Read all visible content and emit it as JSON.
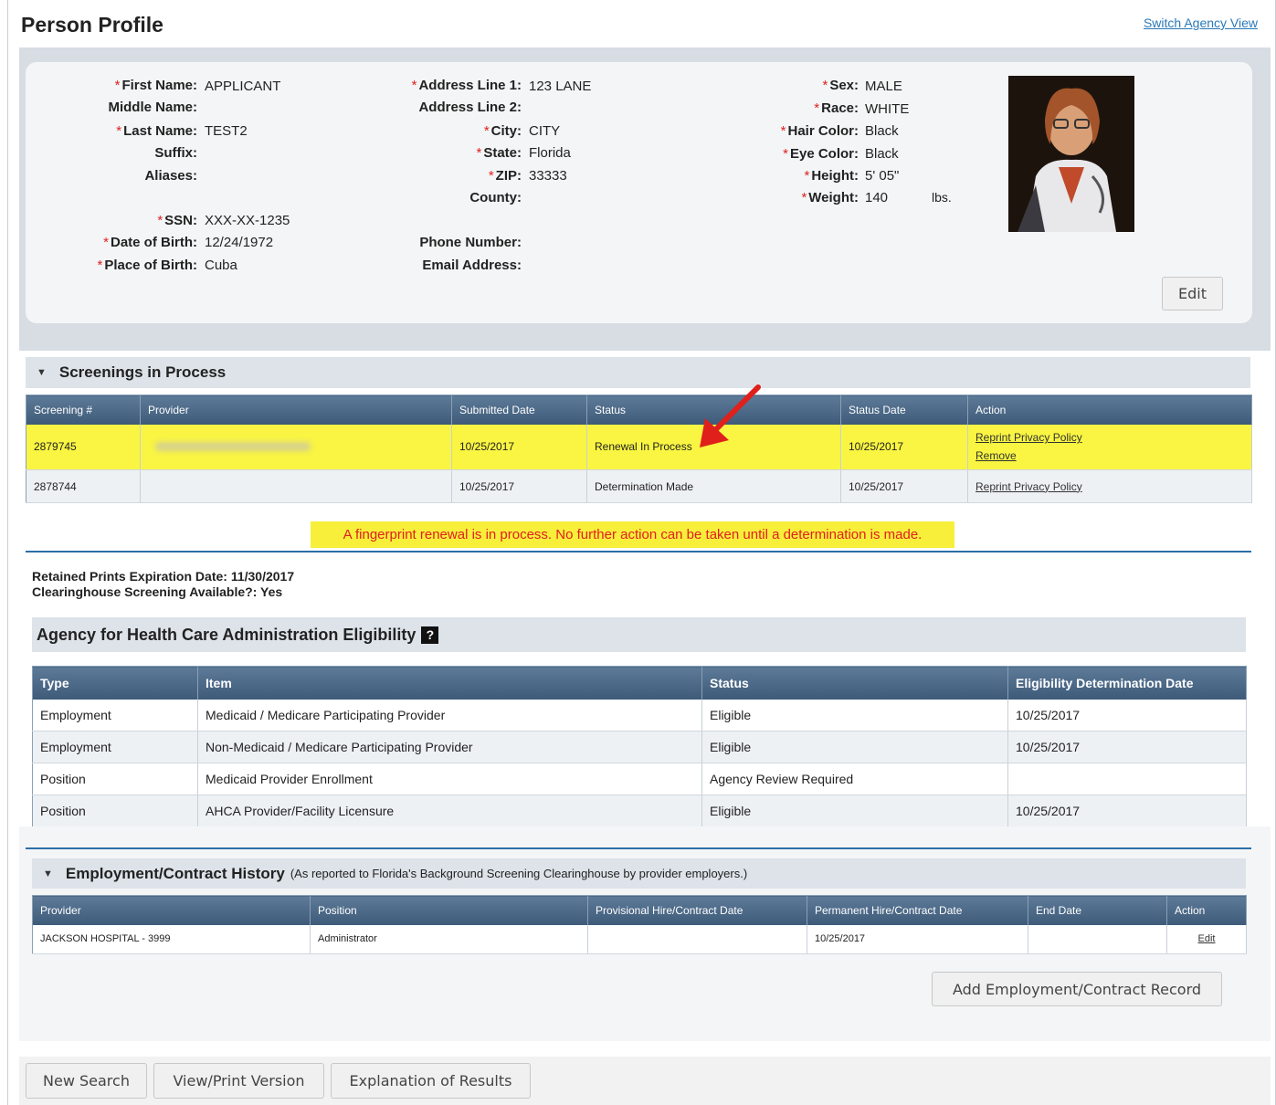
{
  "header": {
    "title": "Person Profile",
    "switch_link": "Switch Agency View"
  },
  "person": {
    "col1": [
      {
        "label": "First Name:",
        "required": true,
        "value": "APPLICANT"
      },
      {
        "label": "Middle Name:",
        "required": false,
        "value": ""
      },
      {
        "label": "Last Name:",
        "required": true,
        "value": "TEST2"
      },
      {
        "label": "Suffix:",
        "required": false,
        "value": ""
      },
      {
        "label": "Aliases:",
        "required": false,
        "value": ""
      },
      {
        "label": "SSN:",
        "required": true,
        "value": "XXX-XX-1235"
      },
      {
        "label": "Date of Birth:",
        "required": true,
        "value": "12/24/1972"
      },
      {
        "label": "Place of Birth:",
        "required": true,
        "value": "Cuba"
      }
    ],
    "col2": [
      {
        "label": "Address Line 1:",
        "required": true,
        "value": "123 LANE"
      },
      {
        "label": "Address Line 2:",
        "required": false,
        "value": ""
      },
      {
        "label": "City:",
        "required": true,
        "value": "CITY"
      },
      {
        "label": "State:",
        "required": true,
        "value": "Florida"
      },
      {
        "label": "ZIP:",
        "required": true,
        "value": "33333"
      },
      {
        "label": "County:",
        "required": false,
        "value": ""
      },
      {
        "label": "Phone Number:",
        "required": false,
        "value": ""
      },
      {
        "label": "Email Address:",
        "required": false,
        "value": ""
      }
    ],
    "col3": [
      {
        "label": "Sex:",
        "required": true,
        "value": "MALE"
      },
      {
        "label": "Race:",
        "required": true,
        "value": "WHITE"
      },
      {
        "label": "Hair Color:",
        "required": true,
        "value": "Black"
      },
      {
        "label": "Eye Color:",
        "required": true,
        "value": "Black"
      },
      {
        "label": "Height:",
        "required": true,
        "value": "5' 05\""
      },
      {
        "label": "Weight:",
        "required": true,
        "value": "140",
        "unit": "lbs."
      }
    ],
    "required_mark": "*",
    "edit_button": "Edit"
  },
  "screenings": {
    "title": "Screenings in Process",
    "columns": [
      "Screening #",
      "Provider",
      "Submitted Date",
      "Status",
      "Status Date",
      "Action"
    ],
    "rows": [
      {
        "number": "2879745",
        "provider": "",
        "submitted": "10/25/2017",
        "status": "Renewal In Process",
        "status_date": "10/25/2017",
        "action1": "Reprint Privacy Policy",
        "action2": "Remove"
      },
      {
        "number": "2878744",
        "provider": "",
        "submitted": "10/25/2017",
        "status": "Determination Made",
        "status_date": "10/25/2017",
        "action1": "Reprint Privacy Policy"
      }
    ],
    "notice": "A fingerprint renewal is in process. No further action can be taken until a determination is made."
  },
  "retained": {
    "expiration": "Retained Prints Expiration Date: 11/30/2017",
    "clearinghouse": "Clearinghouse Screening Available?: Yes"
  },
  "eligibility": {
    "title": "Agency for Health Care Administration Eligibility",
    "help_icon": "?",
    "columns": [
      "Type",
      "Item",
      "Status",
      "Eligibility Determination Date"
    ],
    "rows": [
      {
        "type": "Employment",
        "item": "Medicaid / Medicare Participating Provider",
        "status": "Eligible",
        "date": "10/25/2017"
      },
      {
        "type": "Employment",
        "item": "Non-Medicaid / Medicare Participating Provider",
        "status": "Eligible",
        "date": "10/25/2017"
      },
      {
        "type": "Position",
        "item": "Medicaid Provider Enrollment",
        "status": "Agency Review Required",
        "date": ""
      },
      {
        "type": "Position",
        "item": "AHCA Provider/Facility Licensure",
        "status": "Eligible",
        "date": "10/25/2017"
      }
    ]
  },
  "employment": {
    "title": "Employment/Contract History",
    "subtitle": "(As reported to Florida's Background Screening Clearinghouse by provider employers.)",
    "columns": [
      "Provider",
      "Position",
      "Provisional Hire/Contract Date",
      "Permanent Hire/Contract Date",
      "End Date",
      "Action"
    ],
    "rows": [
      {
        "provider": "JACKSON HOSPITAL - 3999",
        "position": "Administrator",
        "provisional": "",
        "permanent": "10/25/2017",
        "end": "",
        "action": "Edit"
      }
    ],
    "add_button": "Add Employment/Contract Record"
  },
  "footer": {
    "new_search": "New Search",
    "view_print": "View/Print Version",
    "explanation": "Explanation of Results"
  },
  "colors": {
    "highlight": "#f9f542",
    "table_header": "#4b6886",
    "link": "#2a79b8",
    "notice_text": "#e02020",
    "arrow": "#e0201a"
  }
}
